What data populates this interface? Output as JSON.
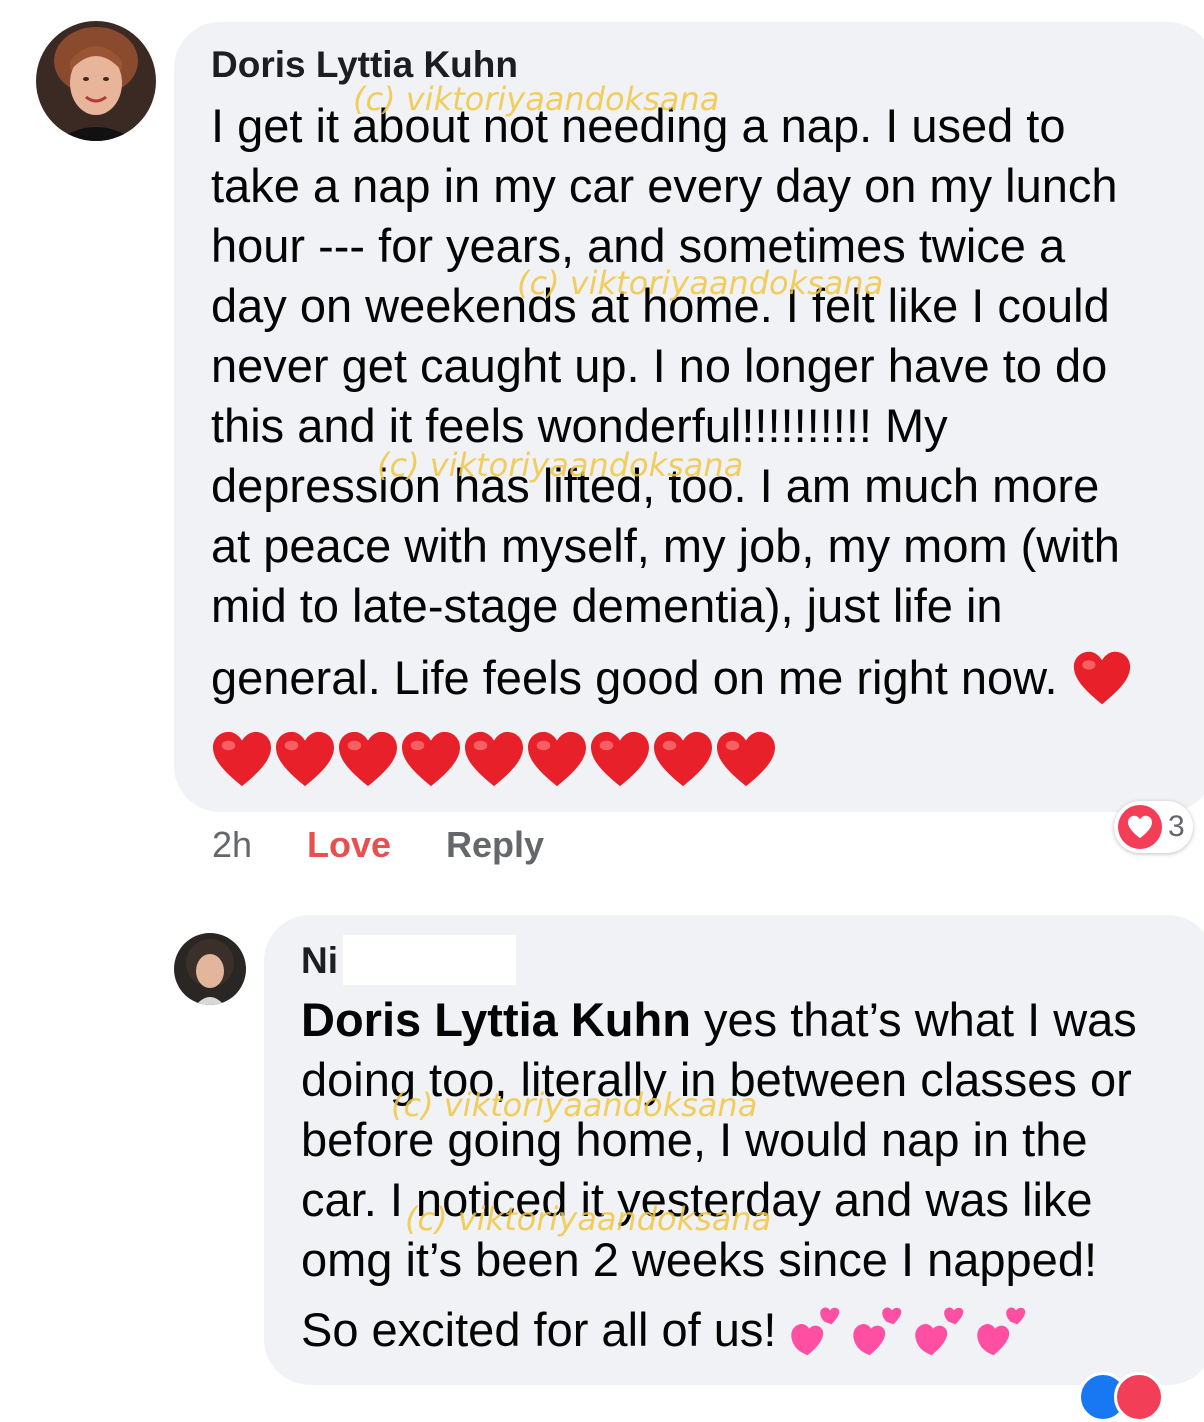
{
  "comment1": {
    "author": "Doris Lyttia Kuhn",
    "text": "I get it about not needing a nap. I used to\ntake a nap in my car every day on my lunch\nhour --- for years, and sometimes twice a\nday on weekends at home. I felt like I could\nnever get caught up. I no longer have to do\nthis and it feels wonderful!!!!!!!!!!  My\ndepression has lifted, too. I am much more\nat peace with myself, my job, my mom (with\nmid to late-stage dementia), just life in",
    "last_line": "general. Life feels good on me right now.",
    "time": "2h",
    "love_label": "Love",
    "reply_label": "Reply",
    "reaction_count": "3",
    "heart_count": 9
  },
  "comment2": {
    "author": "Ni",
    "mention": "Doris Lyttia Kuhn",
    "text": " yes that’s what I was\ndoing too, literally in between classes or\nbefore going home, I would nap in the\ncar. I noticed it yesterday and was like\nomg it’s been 2 weeks since I napped!",
    "last_line": "So excited for all of us!",
    "sparkle_heart_count": 4
  },
  "watermark": "(c) viktoriyaandoksana",
  "colors": {
    "bubble": "#f0f2f5",
    "love": "#e8504f",
    "heart": "#e8202a",
    "sparkle_heart": "#ff4fa3",
    "watermark": "#f2c744",
    "like_blue": "#1877f2"
  }
}
